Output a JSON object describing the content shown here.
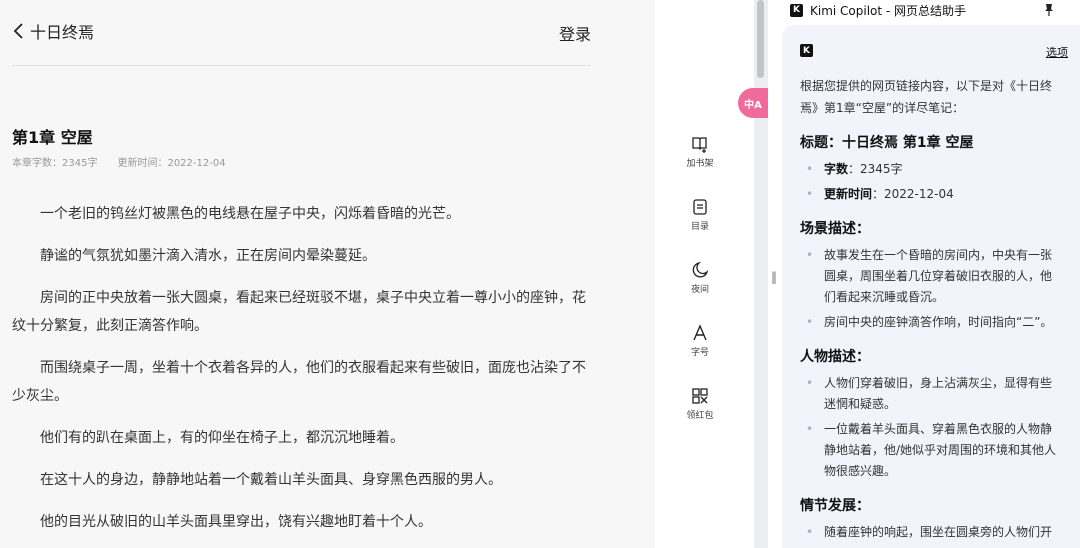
{
  "reader": {
    "book_title": "十日终焉",
    "login_label": "登录",
    "chapter_title": "第1章 空屋",
    "word_count": "本章字数：2345字",
    "update_time": "更新时间：2022-12-04",
    "paragraphs": [
      "一个老旧的钨丝灯被黑色的电线悬在屋子中央，闪烁着昏暗的光芒。",
      "静谧的气氛犹如墨汁滴入清水，正在房间内晕染蔓延。",
      "房间的正中央放着一张大圆桌，看起来已经斑驳不堪，桌子中央立着一尊小小的座钟，花纹十分繁复，此刻正滴答作响。",
      "而围绕桌子一周，坐着十个衣着各异的人，他们的衣服看起来有些破旧，面庞也沾染了不少灰尘。",
      "他们有的趴在桌面上，有的仰坐在椅子上，都沉沉地睡着。",
      "在这十人的身边，静静地站着一个戴着山羊头面具、身穿黑色西服的男人。",
      "他的目光从破旧的山羊头面具里穿出，饶有兴趣地盯着十个人。"
    ]
  },
  "tools": {
    "bookshelf": "加书架",
    "toc": "目录",
    "night": "夜间",
    "font": "字号",
    "redpacket": "领红包"
  },
  "translate_label": "中A",
  "kimi": {
    "title": "Kimi Copilot - 网页总结助手",
    "options_label": "选项",
    "intro": "根据您提供的网页链接内容，以下是对《十日终焉》第1章“空屋”的详尽笔记：",
    "heading_title": "标题：十日终焉 第1章 空屋",
    "word_count_label": "字数",
    "word_count_value": "：2345字",
    "update_label": "更新时间",
    "update_value": "：2022-12-04",
    "scene_heading": "场景描述：",
    "scene_items": [
      "故事发生在一个昏暗的房间内，中央有一张圆桌，周围坐着几位穿着破旧衣服的人，他们看起来沉睡或昏沉。",
      "房间中央的座钟滴答作响，时间指向“二”。"
    ],
    "character_heading": "人物描述：",
    "character_items": [
      "人物们穿着破旧，身上沾满灰尘，显得有些迷惘和疑惑。",
      "一位戴着羊头面具、穿着黑色衣服的人物静静地站着，他/她似乎对周围的环境和其他人物很感兴趣。"
    ],
    "plot_heading": "情节发展：",
    "plot_items": [
      "随着座钟的响起，围坐在圆桌旁的人物们开"
    ]
  },
  "colors": {
    "reader_bg": "#f7f7f7",
    "panel_card_bg": "#f1f4fb",
    "translate_accent": "#f06a9a"
  }
}
